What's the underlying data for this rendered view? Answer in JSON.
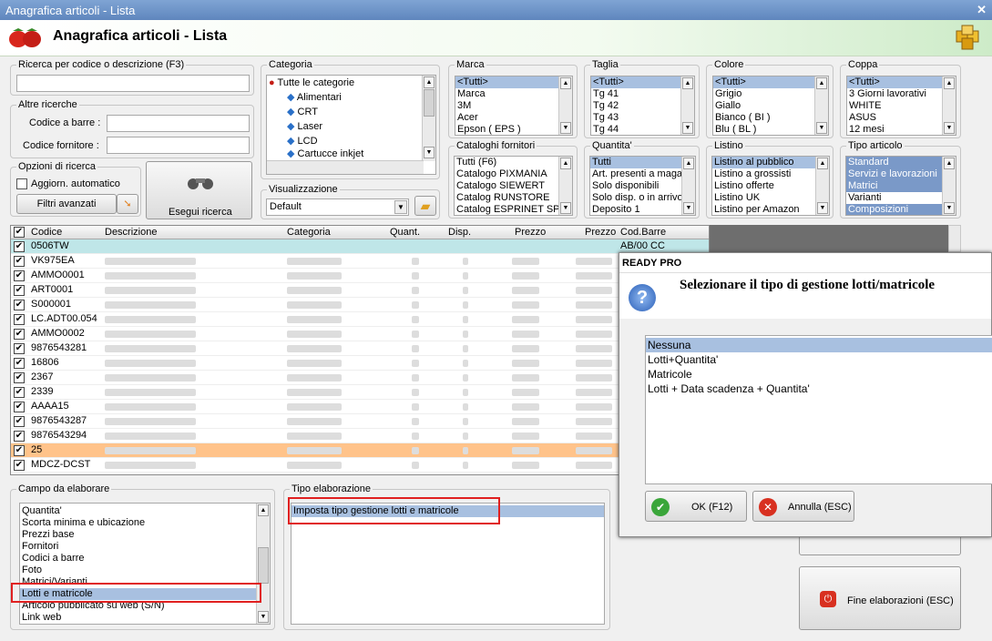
{
  "window": {
    "title": "Anagrafica articoli  - Lista",
    "header_title": "Anagrafica articoli  - Lista"
  },
  "search": {
    "legend": "Ricerca per codice o descrizione (F3)",
    "value": ""
  },
  "altre": {
    "legend": "Altre ricerche",
    "barcode_label": "Codice a barre :",
    "supplier_label": "Codice fornitore :"
  },
  "opzioni": {
    "legend": "Opzioni di ricerca",
    "auto_label": "Aggiorn. automatico",
    "advanced_label": "Filtri avanzati"
  },
  "esegui": {
    "label": "Esegui ricerca"
  },
  "categoria": {
    "legend": "Categoria",
    "root": "Tutte le categorie",
    "items": [
      "Alimentari",
      "CRT",
      "Laser",
      "LCD",
      "Cartucce inkjet"
    ]
  },
  "visualizzazione": {
    "legend": "Visualizzazione",
    "value": "Default"
  },
  "marca": {
    "legend": "Marca",
    "items": [
      "<Tutti>",
      "Marca",
      "3M",
      "Acer",
      "Epson ( EPS )"
    ]
  },
  "taglia": {
    "legend": "Taglia",
    "items": [
      "<Tutti>",
      "Tg 41",
      "Tg 42",
      "Tg 43",
      "Tg 44"
    ]
  },
  "colore": {
    "legend": "Colore",
    "items": [
      "<Tutti>",
      "Grigio",
      "Giallo",
      "Bianco ( BI )",
      "Blu ( BL )"
    ]
  },
  "coppa": {
    "legend": "Coppa",
    "items": [
      "<Tutti>",
      "3 Giorni lavorativi",
      "WHITE",
      "ASUS",
      "12 mesi"
    ]
  },
  "cataloghi": {
    "legend": "Cataloghi fornitori",
    "items": [
      "Tutti (F6)",
      "Catalogo PIXMANIA",
      "Catalogo SIEWERT",
      "Catalog RUNSTORE",
      "Catalog ESPRINET SPA"
    ]
  },
  "quantita": {
    "legend": "Quantita'",
    "items": [
      "Tutti",
      "Art. presenti a magazzino",
      "Solo disponibili",
      "Solo disp. o in arrivo",
      "Deposito 1"
    ]
  },
  "listino": {
    "legend": "Listino",
    "items": [
      "Listino al pubblico",
      "Listino a grossisti",
      "Listino offerte",
      "Listino UK",
      "Listino per Amazon"
    ]
  },
  "tipo_articolo": {
    "legend": "Tipo articolo",
    "items": [
      "Standard",
      "Servizi e lavorazioni",
      "Matrici",
      "Varianti",
      "Composizioni"
    ]
  },
  "grid": {
    "headers": [
      "Codice",
      "Descrizione",
      "Categoria",
      "Quant.",
      "Disp.",
      "Prezzo",
      "Prezzo",
      "Cod.Barre"
    ],
    "rows": [
      "0506TW",
      "VK975EA",
      "AMMO0001",
      "ART0001",
      "S000001",
      "LC.ADT00.054",
      "AMMO0002",
      "9876543281",
      "16806",
      "2367",
      "2339",
      "AAAA15",
      "9876543287",
      "9876543294",
      "25",
      "MDCZ-DCST"
    ],
    "first_barcode": "AB/00 CC"
  },
  "campo": {
    "legend": "Campo da elaborare",
    "items": [
      "Quantita'",
      "Scorta minima e ubicazione",
      "Prezzi base",
      "Fornitori",
      "Codici a barre",
      "Foto",
      "Matrici/Varianti",
      "Lotti e matricole",
      "Articolo pubblicato su web (S/N)",
      "Link web"
    ]
  },
  "tipo_elab": {
    "legend": "Tipo elaborazione",
    "item": "Imposta tipo gestione lotti e matricole"
  },
  "fine": {
    "label": "Fine elaborazioni (ESC)"
  },
  "dialog": {
    "title": "READY PRO",
    "message": "Selezionare il tipo di gestione lotti/matricole",
    "options": [
      "Nessuna",
      "Lotti+Quantita'",
      "Matricole",
      "Lotti + Data scadenza + Quantita'"
    ],
    "ok": "OK (F12)",
    "cancel": "Annulla (ESC)"
  }
}
